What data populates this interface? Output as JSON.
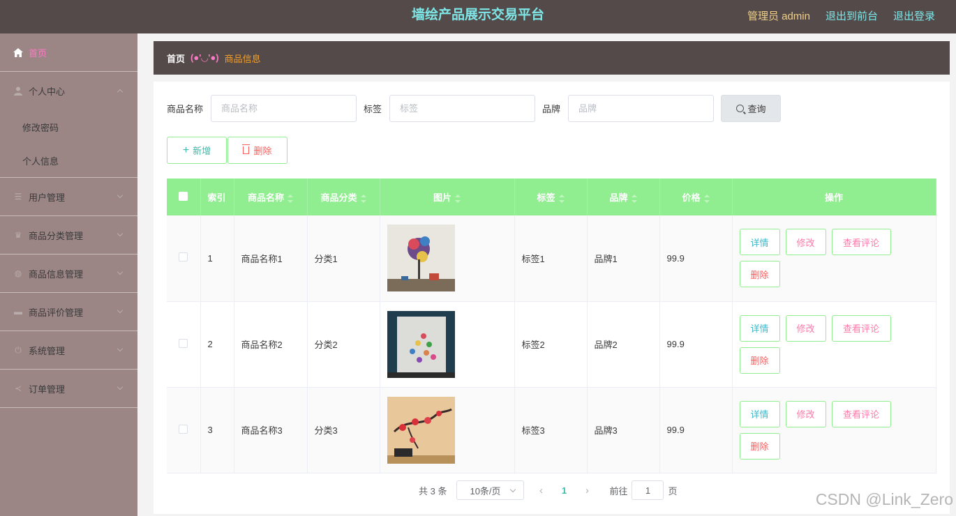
{
  "header": {
    "title": "墙绘产品展示交易平台",
    "admin_label": "管理员 admin",
    "front_link": "退出到前台",
    "logout_link": "退出登录"
  },
  "sidebar": {
    "home": "首页",
    "personal_center": "个人中心",
    "sub_items": [
      "修改密码",
      "个人信息"
    ],
    "items": [
      "用户管理",
      "商品分类管理",
      "商品信息管理",
      "商品评价管理",
      "系统管理",
      "订单管理"
    ]
  },
  "breadcrumb": {
    "home": "首页",
    "face": "(●'◡'●)",
    "current": "商品信息"
  },
  "search": {
    "name_label": "商品名称",
    "name_placeholder": "商品名称",
    "tag_label": "标签",
    "tag_placeholder": "标签",
    "brand_label": "品牌",
    "brand_placeholder": "品牌",
    "query_button": "查询"
  },
  "actions": {
    "add": "新增",
    "delete": "删除"
  },
  "table": {
    "headers": [
      "索引",
      "商品名称",
      "商品分类",
      "图片",
      "标签",
      "品牌",
      "价格",
      "操作"
    ],
    "rows": [
      {
        "index": "1",
        "name": "商品名称1",
        "category": "分类1",
        "tag": "标签1",
        "brand": "品牌1",
        "price": "99.9"
      },
      {
        "index": "2",
        "name": "商品名称2",
        "category": "分类2",
        "tag": "标签2",
        "brand": "品牌2",
        "price": "99.9"
      },
      {
        "index": "3",
        "name": "商品名称3",
        "category": "分类3",
        "tag": "标签3",
        "brand": "品牌3",
        "price": "99.9"
      }
    ],
    "ops": {
      "detail": "详情",
      "edit": "修改",
      "comment": "查看评论",
      "remove": "删除"
    }
  },
  "pagination": {
    "total": "共 3 条",
    "page_size": "10条/页",
    "current_page": "1",
    "goto_label": "前往",
    "goto_value": "1",
    "page_suffix": "页"
  },
  "watermark": "CSDN @Link_Zero",
  "colors": {
    "header_bg": "#544a4a",
    "sidebar_bg": "#9b8585",
    "table_header": "#90ee90",
    "accent_cyan": "#7ee6e6",
    "accent_pink": "#ff79c6"
  }
}
